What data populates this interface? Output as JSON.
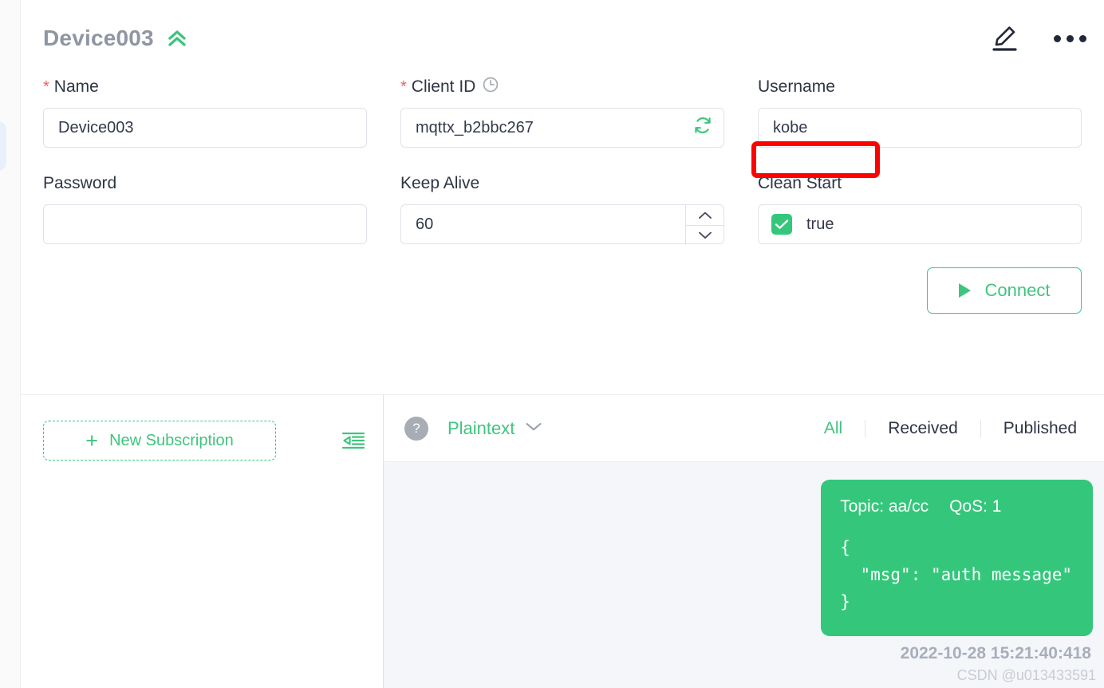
{
  "connection": {
    "title": "Device003",
    "collapse_icon": "double-chevron-up-icon",
    "edit_icon": "pencil-edit-icon",
    "more_icon": "more-horizontal-icon"
  },
  "form": {
    "name": {
      "label": "Name",
      "required_marker": "*",
      "value": "Device003",
      "placeholder": ""
    },
    "client_id": {
      "label": "Client ID",
      "required_marker": "*",
      "value": "mqttx_b2bbc267",
      "placeholder": "",
      "suffix_icon": "refresh-icon",
      "label_icon": "clock-icon"
    },
    "username": {
      "label": "Username",
      "value": "kobe",
      "placeholder": ""
    },
    "password": {
      "label": "Password",
      "value": "",
      "placeholder": ""
    },
    "keep_alive": {
      "label": "Keep Alive",
      "value": "60",
      "placeholder": "",
      "increment_icon": "chevron-up-icon",
      "decrement_icon": "chevron-down-icon"
    },
    "clean_start": {
      "label": "Clean Start",
      "value": "true",
      "checked": true
    },
    "connect_button": {
      "label": "Connect",
      "icon": "play-icon"
    }
  },
  "subscriptions": {
    "new_subscription_label": "New Subscription",
    "plus_glyph": "+",
    "collapse_panel_icon": "collapse-left-panel-icon"
  },
  "messages": {
    "help_icon": "question-mark-icon",
    "format": {
      "label": "Plaintext",
      "chevron_icon": "chevron-down-icon"
    },
    "filters": [
      {
        "label": "All",
        "active": true
      },
      {
        "label": "Received",
        "active": false
      },
      {
        "label": "Published",
        "active": false
      }
    ],
    "items": [
      {
        "topic_label": "Topic: aa/cc",
        "qos_label": "QoS: 1",
        "payload": "{\n  \"msg\": \"auth message\"\n}",
        "timestamp": "2022-10-28 15:21:40:418",
        "direction": "published"
      }
    ]
  },
  "annotation": {
    "color": "#ff0000",
    "target": "username-input"
  },
  "watermark": {
    "text": "CSDN @u013433591"
  },
  "theme": {
    "accent_green": "#3fc47f",
    "bubble_green": "#34c77b",
    "title_gray": "#8f95a3",
    "text_dark": "#2e3545",
    "border": "#dfe2ea",
    "panel_bg": "#f4f6fa"
  }
}
